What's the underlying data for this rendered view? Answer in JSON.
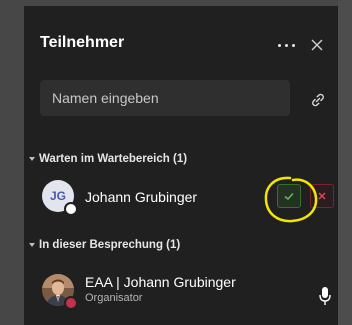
{
  "panel": {
    "title": "Teilnehmer",
    "search_placeholder": "Namen eingeben"
  },
  "lobby": {
    "header": "Warten im Wartebereich (1)",
    "participants": [
      {
        "initials": "JG",
        "name": "Johann Grubinger",
        "status": "white"
      }
    ],
    "admit_icon": "check-icon",
    "deny_icon": "x-icon"
  },
  "meeting": {
    "header": "In dieser Besprechung (1)",
    "participants": [
      {
        "name": "EAA | Johann Grubinger",
        "role": "Organisator",
        "status": "red",
        "mic_icon": "microphone-icon"
      }
    ]
  },
  "colors": {
    "panel_bg": "#202020",
    "accent_green": "#5cb85c",
    "accent_red": "#e04356",
    "highlight_yellow": "#f2e600"
  }
}
